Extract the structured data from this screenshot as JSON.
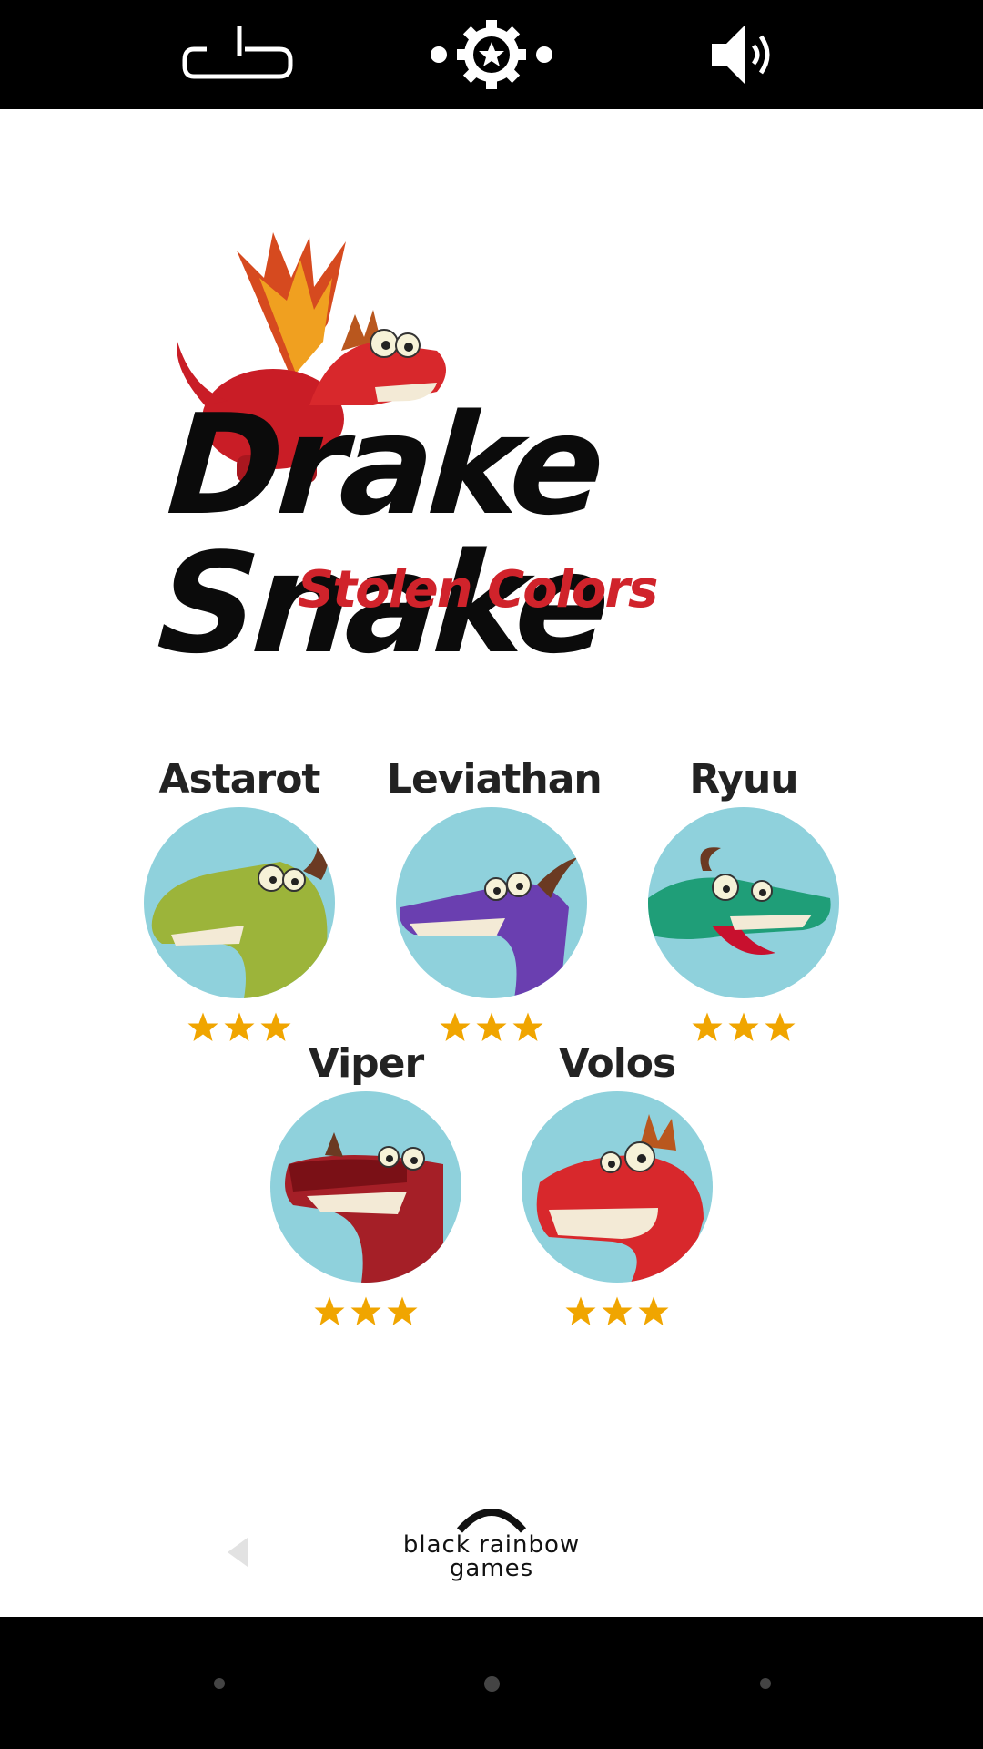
{
  "top_bar": {
    "exit_icon": "power-exit-icon",
    "achievements_icon": "star-gear-icon",
    "sound_icon": "speaker-sound-icon"
  },
  "logo": {
    "title": "Drake Snake",
    "subtitle": "Stolen Colors",
    "title_color": "#0b0b0b",
    "subtitle_color": "#d0232b"
  },
  "characters": [
    {
      "name": "Astarot",
      "stars": 3,
      "color": "#9cb43a"
    },
    {
      "name": "Leviathan",
      "stars": 3,
      "color": "#6a3fb0"
    },
    {
      "name": "Ryuu",
      "stars": 3,
      "color": "#1f9e78"
    },
    {
      "name": "Viper",
      "stars": 3,
      "color": "#a51f27"
    },
    {
      "name": "Volos",
      "stars": 3,
      "color": "#d8282c"
    }
  ],
  "footer": {
    "back_icon": "back-arrow-icon",
    "studio_line1": "black rainbow",
    "studio_line2": "games"
  },
  "colors": {
    "star": "#f0a500",
    "portrait_bg": "#8fd1dc"
  }
}
